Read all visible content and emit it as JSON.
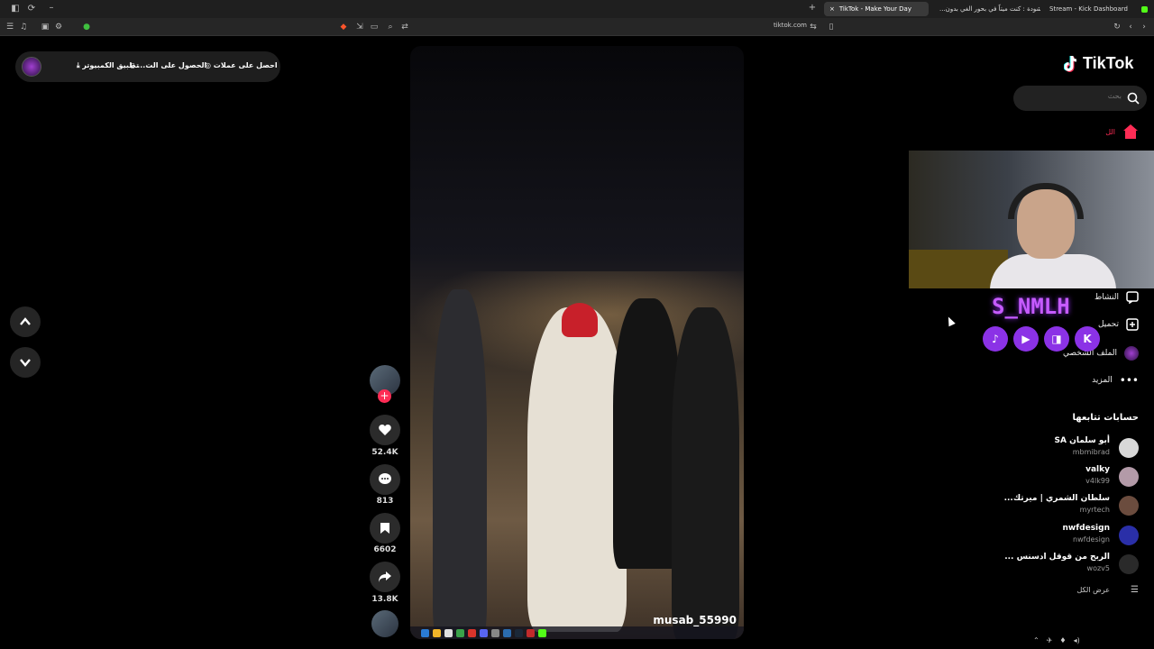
{
  "browser": {
    "tabs": [
      {
        "label": "TikTok - Make Your Day",
        "active": true
      },
      {
        "label": "أنشودة : كنت ميتاً في بحور الغي بدون...",
        "active": false
      },
      {
        "label": "Stream - Kick Dashboard",
        "active": false
      }
    ],
    "url": "tiktok.com"
  },
  "getbar": {
    "coins": "احصل على عملات",
    "app": "الحصول على الت...",
    "desktop": "تطبيق الكمبيوتر"
  },
  "video": {
    "creator": "musab_55990",
    "likes": "52.4K",
    "comments": "813",
    "saves": "6602",
    "shares": "13.8K"
  },
  "sidebar": {
    "logo": "TikTok",
    "search_placeholder": "بحث",
    "home": "الل",
    "activity": "النشاط",
    "upload": "تحميل",
    "profile": "الملف الشخصي",
    "more": "المزيد",
    "following_title": "حسابات تتابعها",
    "following": [
      {
        "name": "أبو سلمان SA",
        "handle": "mbmibrad",
        "color": "#d8d8d8"
      },
      {
        "name": "valky",
        "handle": "v4lk99",
        "color": "#b39aa8"
      },
      {
        "name": "سلطان الشمري | ميرتك...",
        "handle": "myrtech",
        "color": "#6b4c3e"
      },
      {
        "name": "nwfdesign",
        "handle": "nwfdesign",
        "color": "#2a2fa8"
      },
      {
        "name": "الربح من قوقل ادسنس ...",
        "handle": "wozv5",
        "color": "#2a2a2a"
      }
    ],
    "see_all": "عرض الكل"
  },
  "stream_overlay": {
    "name": "S_NMLH"
  },
  "colors": {
    "accent": "#fe2c55",
    "overlay_purple": "#8b32e6"
  }
}
